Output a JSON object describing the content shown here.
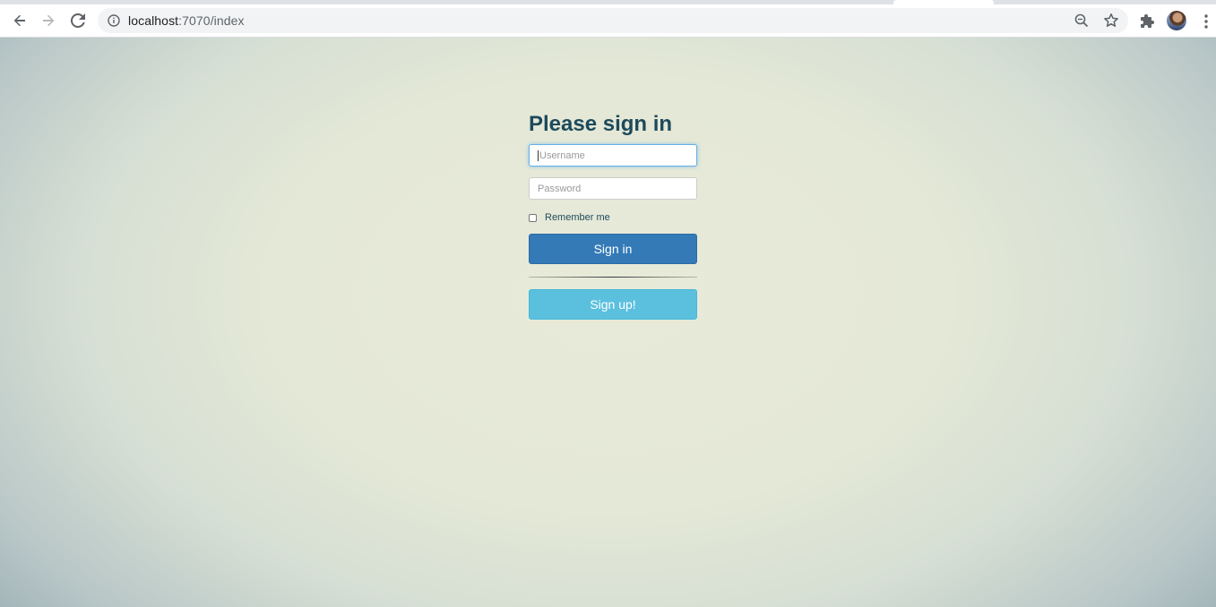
{
  "browser": {
    "url_host": "localhost",
    "url_path": ":7070/index",
    "icons": {
      "back": "arrow-left-icon",
      "forward": "arrow-right-icon",
      "reload": "reload-icon",
      "site_info": "info-icon",
      "zoom": "zoom-out-icon",
      "bookmark": "star-icon",
      "extensions": "puzzle-icon",
      "menu": "kebab-menu-icon"
    }
  },
  "login": {
    "title": "Please sign in",
    "username_placeholder": "Username",
    "password_placeholder": "Password",
    "remember_label": "Remember me",
    "sign_in_label": "Sign in",
    "sign_up_label": "Sign up!"
  },
  "colors": {
    "heading": "#1d4a5c",
    "primary": "#337ab7",
    "info": "#5bc0de"
  }
}
